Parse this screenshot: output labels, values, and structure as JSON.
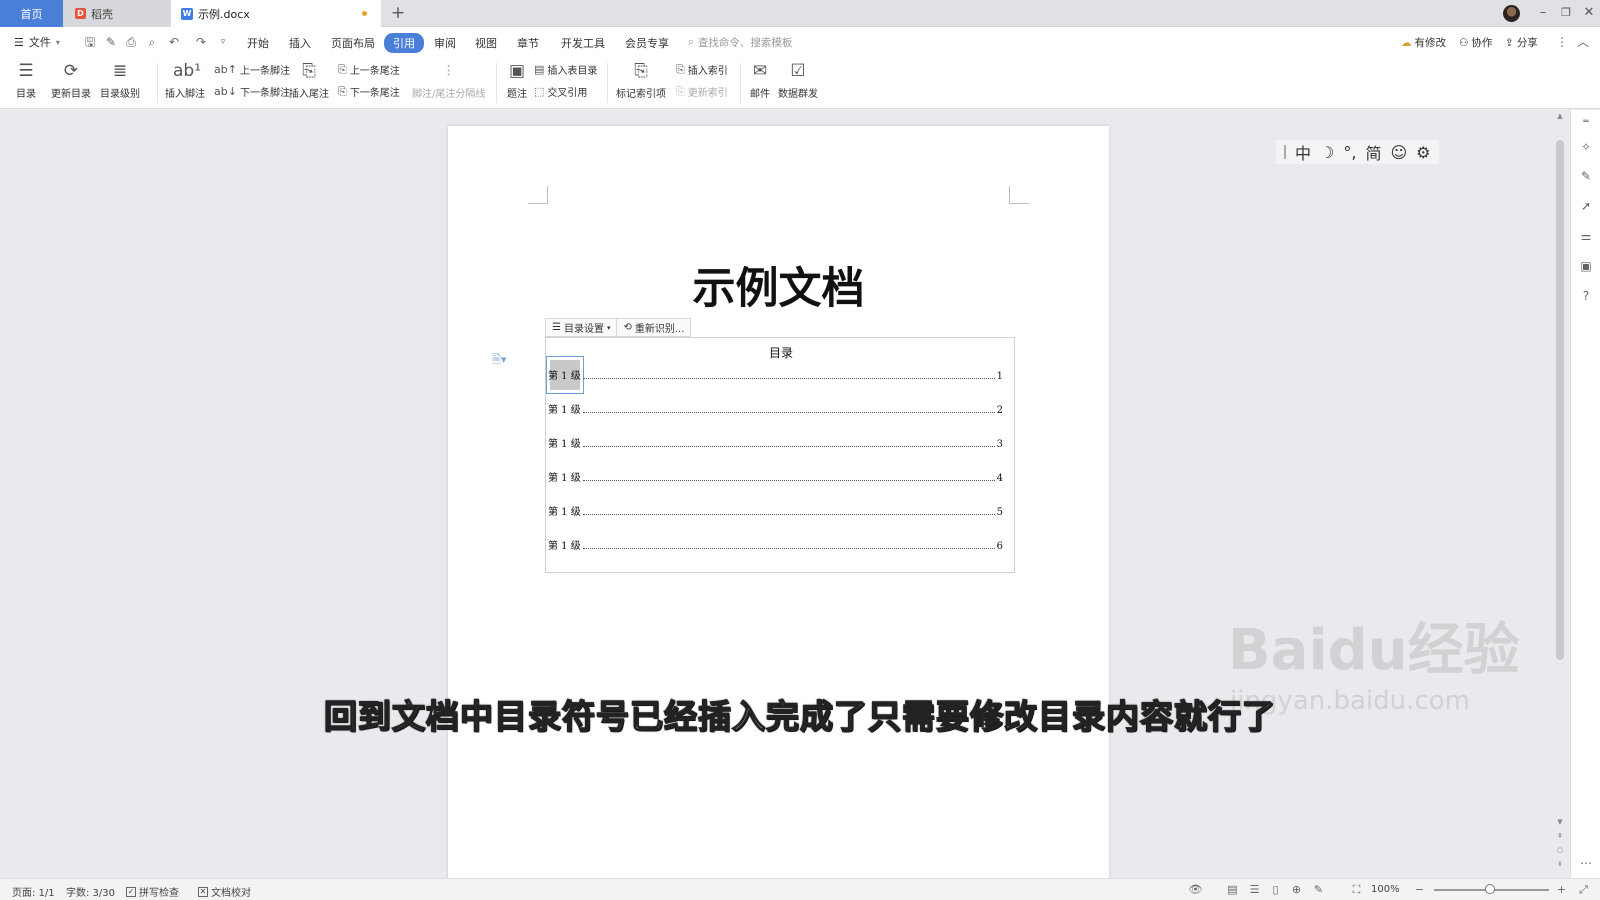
{
  "tabs": {
    "home": "首页",
    "daoke": "稻壳",
    "doc": "示例.docx",
    "add": "+"
  },
  "window": {
    "minimize": "–",
    "restore": "❐",
    "close": "✕"
  },
  "menu": {
    "file": "文件",
    "items": [
      "开始",
      "插入",
      "页面布局",
      "引用",
      "审阅",
      "视图",
      "章节",
      "开发工具",
      "会员专享"
    ],
    "active": "引用",
    "search_placeholder": "查找命令、搜索模板",
    "right": {
      "modified": "有修改",
      "collab": "协作",
      "share": "分享"
    }
  },
  "ribbon": {
    "toc": "目录",
    "update_toc": "更新目录",
    "toc_level": "目录级别",
    "insert_footnote": "插入脚注",
    "prev_footnote": "上一条脚注",
    "next_footnote": "下一条脚注",
    "insert_endnote": "插入尾注",
    "prev_endnote": "上一条尾注",
    "next_endnote": "下一条尾注",
    "separator": "脚注/尾注分隔线",
    "caption": "题注",
    "insert_table_toc": "插入表目录",
    "cross_ref": "交叉引用",
    "mark_index": "标记索引项",
    "insert_index": "插入索引",
    "update_index": "更新索引",
    "mail": "邮件",
    "data_mail": "数据群发"
  },
  "document": {
    "title": "示例文档",
    "toc_settings": "目录设置",
    "re_identify": "重新识别...",
    "toc_heading": "目录",
    "toc_entries": [
      {
        "label": "第 1 级",
        "page": "1"
      },
      {
        "label": "第 1 级",
        "page": "2"
      },
      {
        "label": "第 1 级",
        "page": "3"
      },
      {
        "label": "第 1 级",
        "page": "4"
      },
      {
        "label": "第 1 级",
        "page": "5"
      },
      {
        "label": "第 1 级",
        "page": "6"
      }
    ]
  },
  "ime": {
    "lang": "中",
    "mode": "简"
  },
  "subtitle": "回到文档中目录符号已经插入完成了只需要修改目录内容就行了",
  "watermark": {
    "brand": "Baidu经验",
    "url": "jingyan.baidu.com"
  },
  "status": {
    "page": "页面: 1/1",
    "words": "字数: 3/30",
    "spellcheck": "拼写检查",
    "proofread": "文档校对",
    "zoom": "100%"
  },
  "colors": {
    "accent": "#4a7fd8",
    "selection": "#c9c9c9"
  }
}
